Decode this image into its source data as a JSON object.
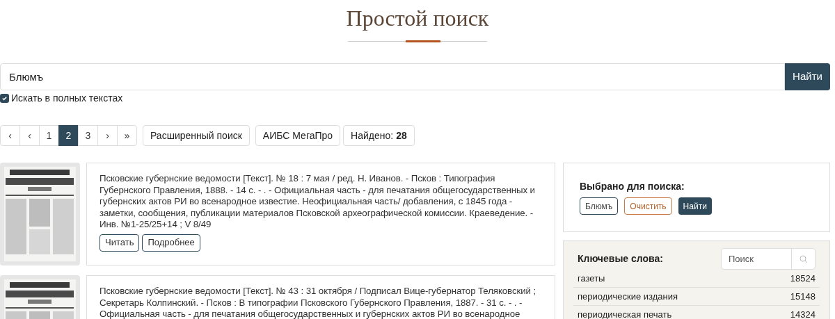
{
  "title": "Простой поиск",
  "search": {
    "value": "Блюмъ",
    "button": "Найти"
  },
  "fulltext": {
    "label": "Искать в полных текстах",
    "checked": true
  },
  "pagination": [
    {
      "label": "‹",
      "selected": false
    },
    {
      "label": "‹",
      "selected": false
    },
    {
      "label": "1",
      "selected": false
    },
    {
      "label": "2",
      "selected": true
    },
    {
      "label": "3",
      "selected": false
    },
    {
      "label": "›",
      "selected": false
    },
    {
      "label": "»",
      "selected": false
    }
  ],
  "tools": [
    "Расширенный поиск",
    "АИБС МегаПро"
  ],
  "found": {
    "label": "Найдено:",
    "count": "28"
  },
  "results": [
    {
      "kind": "picture",
      "text": "Псковские губернские ведомости [Текст]. № 18 : 7 мая / ред. Н. Иванов. - Псков : Типография Губернского Правления, 1888. - 14 с. - . - Официальная часть - для печатания общегосударственных и губернских актов РИ во всенародное известие. Неофициальная часть/ добавления, с 1845 года - заметки, сообщения, публикации материалов Псковской археографической комиссии. Краеведение. - Инв. №1-25/25+14 ; V 8/49",
      "buttons": [
        "Читать",
        "Подробнее"
      ]
    },
    {
      "kind": "picture",
      "text": "Псковские губернские ведомости [Текст]. № 43 : 31 октября / Подписал Вице-губернатор Теляковский ; Секретарь Колпинский. - Псков : В типографии Псковского Губернского Правления, 1887. - 31 с. - . - Официальная часть - для печатания общегосударственных и губернских актов РИ во всенародное"
    }
  ],
  "selected_panel": {
    "title": "Выбрано для поиска:",
    "term": "Блюмъ",
    "clear": "Очистить",
    "find": "Найти"
  },
  "keywords": {
    "title": "Ключевые слова:",
    "placeholder": "Поиск",
    "items": [
      {
        "name": "газеты",
        "count": "18524"
      },
      {
        "name": "периодические издания",
        "count": "15148"
      },
      {
        "name": "периодическая печать",
        "count": "14324"
      }
    ]
  }
}
